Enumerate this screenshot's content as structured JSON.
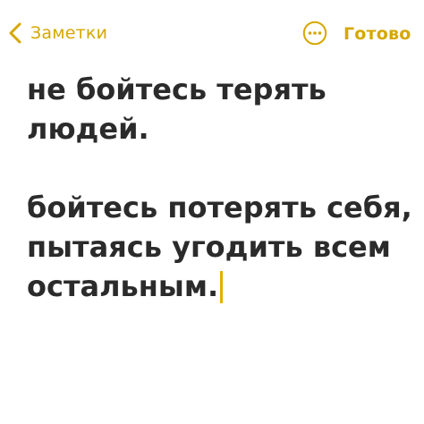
{
  "nav": {
    "back_label": "Заметки",
    "done_label": "Готово",
    "back_icon": "chevron-left-icon",
    "more_icon": "ellipsis-circle-icon"
  },
  "note": {
    "paragraph1": [
      "не бойтесь терять",
      "людей."
    ],
    "paragraph2": [
      "бойтесь потерять себя,",
      "пытаясь угодить всем",
      "остальным."
    ]
  },
  "colors": {
    "accent": "#d6a700",
    "text": "#2b2b2b",
    "cursor": "#e0b000",
    "background": "#ffffff"
  }
}
